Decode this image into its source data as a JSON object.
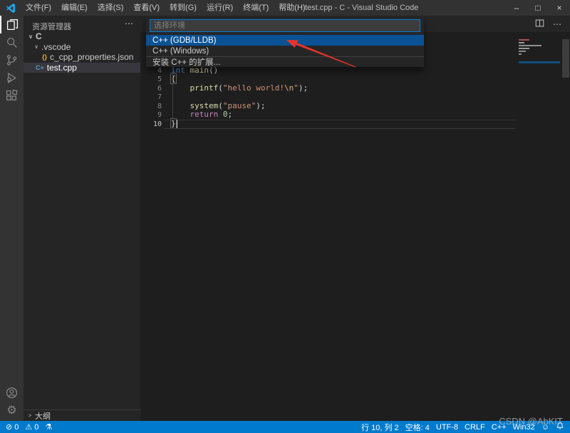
{
  "window": {
    "title": "test.cpp - C - Visual Studio Code"
  },
  "menu": {
    "items": [
      "文件(F)",
      "编辑(E)",
      "选择(S)",
      "查看(V)",
      "转到(G)",
      "运行(R)",
      "终端(T)",
      "帮助(H)"
    ]
  },
  "icons": {
    "minimize": "–",
    "maximize": "□",
    "close": "×",
    "more": "⋯",
    "chevron_expanded": "∨",
    "chevron_collapsed": ">",
    "json_braces": "{}",
    "cpp_glyph": "C+",
    "error": "⊘",
    "warning": "⚠",
    "beaker": "⚗",
    "smiley": "☺",
    "gear": "⚙"
  },
  "sidebar": {
    "title": "资源管理器",
    "outline_label": "大纲",
    "tree": [
      {
        "label": "C",
        "icon": "chevron-expanded",
        "indent": 5,
        "bold": true,
        "selected": false
      },
      {
        "label": ".vscode",
        "icon": "chevron-expanded",
        "indent": 13,
        "bold": false,
        "selected": false
      },
      {
        "label": "c_cpp_properties.json",
        "icon": "json",
        "indent": 26,
        "bold": false,
        "selected": false
      },
      {
        "label": "test.cpp",
        "icon": "cpp",
        "indent": 17,
        "bold": false,
        "selected": true
      }
    ]
  },
  "quick_pick": {
    "placeholder": "选择环境",
    "items": [
      {
        "label": "C++ (GDB/LLDB)",
        "selected": true,
        "separator": false
      },
      {
        "label": "C++ (Windows)",
        "selected": false,
        "separator": false
      },
      {
        "label": "安装 C++ 的扩展...",
        "selected": false,
        "separator": true
      }
    ]
  },
  "editor": {
    "lines": [
      {
        "num": "4",
        "current": false,
        "tokens": [
          {
            "t": "int ",
            "c": "type"
          },
          {
            "t": "main",
            "c": "fn"
          },
          {
            "t": "()",
            "c": "plain"
          }
        ]
      },
      {
        "num": "5",
        "current": false,
        "tokens": [
          {
            "t": "{",
            "c": "bracket"
          }
        ]
      },
      {
        "num": "6",
        "current": false,
        "tokens": [
          {
            "t": "    ",
            "c": "plain"
          },
          {
            "t": "printf",
            "c": "fn"
          },
          {
            "t": "(",
            "c": "plain"
          },
          {
            "t": "\"hello world!",
            "c": "str"
          },
          {
            "t": "\\n",
            "c": "esc"
          },
          {
            "t": "\"",
            "c": "str"
          },
          {
            "t": ");",
            "c": "plain"
          }
        ]
      },
      {
        "num": "7",
        "current": false,
        "tokens": []
      },
      {
        "num": "8",
        "current": false,
        "tokens": [
          {
            "t": "    ",
            "c": "plain"
          },
          {
            "t": "system",
            "c": "fn"
          },
          {
            "t": "(",
            "c": "plain"
          },
          {
            "t": "\"pause\"",
            "c": "str"
          },
          {
            "t": ");",
            "c": "plain"
          }
        ]
      },
      {
        "num": "9",
        "current": false,
        "tokens": [
          {
            "t": "    ",
            "c": "plain"
          },
          {
            "t": "return",
            "c": "kw"
          },
          {
            "t": " ",
            "c": "plain"
          },
          {
            "t": "0",
            "c": "num"
          },
          {
            "t": ";",
            "c": "plain"
          }
        ]
      },
      {
        "num": "10",
        "current": true,
        "tokens": [
          {
            "t": "}",
            "c": "bracket"
          }
        ]
      }
    ]
  },
  "status_bar": {
    "left": [
      {
        "icon": "error",
        "label": "0"
      },
      {
        "icon": "warning",
        "label": "0"
      },
      {
        "icon": "beaker",
        "label": ""
      }
    ],
    "right": [
      {
        "icon": "",
        "label": "行 10, 列 2"
      },
      {
        "icon": "",
        "label": "空格: 4"
      },
      {
        "icon": "",
        "label": "UTF-8"
      },
      {
        "icon": "",
        "label": "CRLF"
      },
      {
        "icon": "",
        "label": "C++"
      },
      {
        "icon": "",
        "label": "Win32"
      },
      {
        "icon": "smiley",
        "label": ""
      },
      {
        "icon": "bell",
        "label": ""
      }
    ]
  },
  "watermark": {
    "text": "CSDN @AbKIT"
  },
  "colors": {
    "status_bar": "#007acc",
    "quickpick_selection": "#0a5295",
    "editor_bg": "#1e1e1e",
    "sidebar_bg": "#252526",
    "titlebar_bg": "#323233",
    "activitybar_bg": "#333333",
    "focus_border": "#007fd4",
    "arrow_annotation": "#e8332a"
  }
}
